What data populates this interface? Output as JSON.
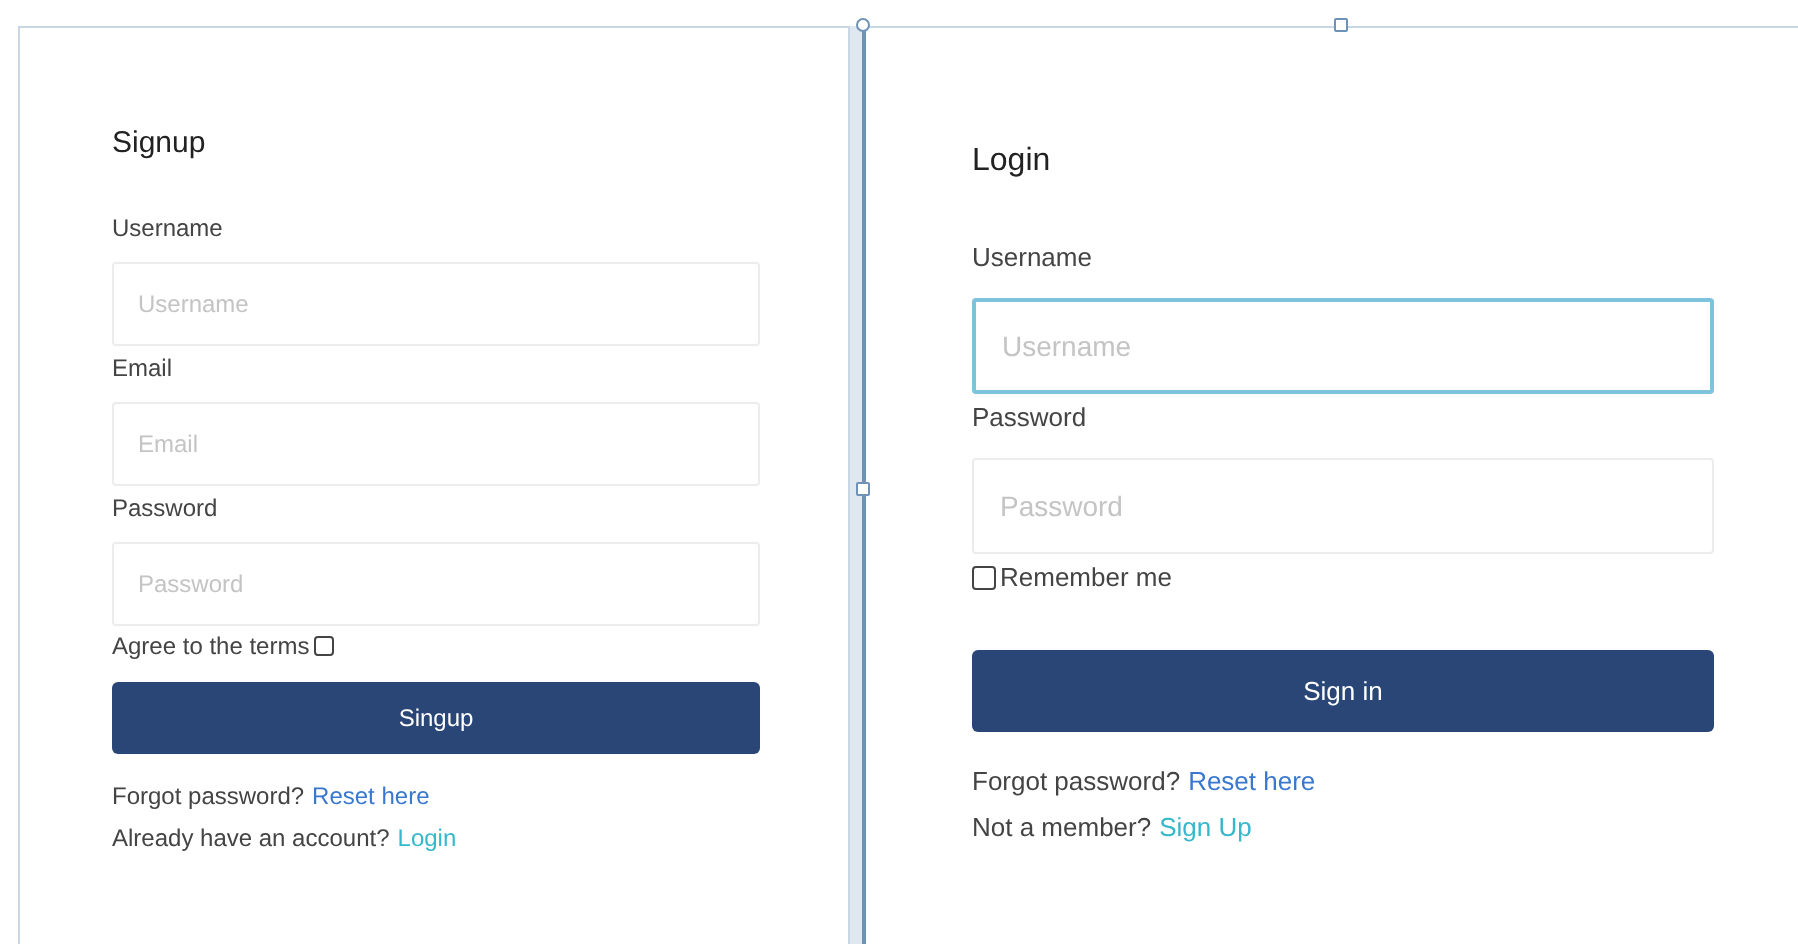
{
  "signup": {
    "title": "Signup",
    "fields": [
      {
        "label": "Username",
        "placeholder": "Username",
        "focused": false
      },
      {
        "label": "Email",
        "placeholder": "Email",
        "focused": false
      },
      {
        "label": "Password",
        "placeholder": "Password",
        "focused": false
      }
    ],
    "checkbox": {
      "label": "Agree to the terms",
      "checked": false
    },
    "button": "Singup",
    "links": [
      {
        "text": "Forgot password?",
        "link": "Reset here",
        "kind": "reset"
      },
      {
        "text": "Already have an account?",
        "link": "Login",
        "kind": "switch"
      }
    ]
  },
  "login": {
    "title": "Login",
    "fields": [
      {
        "label": "Username",
        "placeholder": "Username",
        "focused": true
      },
      {
        "label": "Password",
        "placeholder": "Password",
        "focused": false
      }
    ],
    "checkbox": {
      "label": "Remember me",
      "checked": false
    },
    "button": "Sign in",
    "links": [
      {
        "text": "Forgot password?",
        "link": "Reset here",
        "kind": "reset"
      },
      {
        "text": "Not a member?",
        "link": "Sign Up",
        "kind": "switch"
      }
    ]
  }
}
